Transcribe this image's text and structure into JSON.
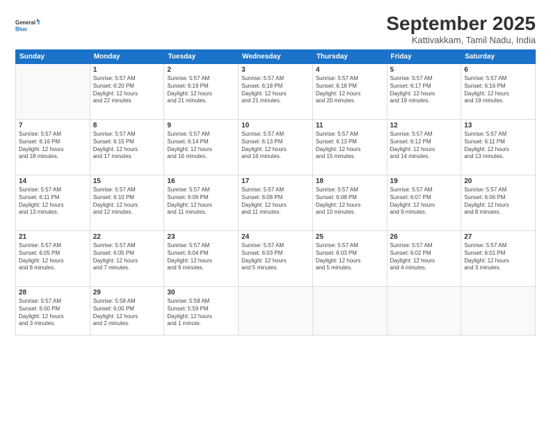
{
  "logo": {
    "line1": "General",
    "line2": "Blue"
  },
  "title": "September 2025",
  "subtitle": "Kattivakkam, Tamil Nadu, India",
  "weekdays": [
    "Sunday",
    "Monday",
    "Tuesday",
    "Wednesday",
    "Thursday",
    "Friday",
    "Saturday"
  ],
  "weeks": [
    [
      {
        "day": "",
        "info": ""
      },
      {
        "day": "1",
        "info": "Sunrise: 5:57 AM\nSunset: 6:20 PM\nDaylight: 12 hours\nand 22 minutes."
      },
      {
        "day": "2",
        "info": "Sunrise: 5:57 AM\nSunset: 6:19 PM\nDaylight: 12 hours\nand 21 minutes."
      },
      {
        "day": "3",
        "info": "Sunrise: 5:57 AM\nSunset: 6:18 PM\nDaylight: 12 hours\nand 21 minutes."
      },
      {
        "day": "4",
        "info": "Sunrise: 5:57 AM\nSunset: 6:18 PM\nDaylight: 12 hours\nand 20 minutes."
      },
      {
        "day": "5",
        "info": "Sunrise: 5:57 AM\nSunset: 6:17 PM\nDaylight: 12 hours\nand 19 minutes."
      },
      {
        "day": "6",
        "info": "Sunrise: 5:57 AM\nSunset: 6:16 PM\nDaylight: 12 hours\nand 19 minutes."
      }
    ],
    [
      {
        "day": "7",
        "info": "Sunrise: 5:57 AM\nSunset: 6:16 PM\nDaylight: 12 hours\nand 18 minutes."
      },
      {
        "day": "8",
        "info": "Sunrise: 5:57 AM\nSunset: 6:15 PM\nDaylight: 12 hours\nand 17 minutes."
      },
      {
        "day": "9",
        "info": "Sunrise: 5:57 AM\nSunset: 6:14 PM\nDaylight: 12 hours\nand 16 minutes."
      },
      {
        "day": "10",
        "info": "Sunrise: 5:57 AM\nSunset: 6:13 PM\nDaylight: 12 hours\nand 16 minutes."
      },
      {
        "day": "11",
        "info": "Sunrise: 5:57 AM\nSunset: 6:13 PM\nDaylight: 12 hours\nand 15 minutes."
      },
      {
        "day": "12",
        "info": "Sunrise: 5:57 AM\nSunset: 6:12 PM\nDaylight: 12 hours\nand 14 minutes."
      },
      {
        "day": "13",
        "info": "Sunrise: 5:57 AM\nSunset: 6:11 PM\nDaylight: 12 hours\nand 13 minutes."
      }
    ],
    [
      {
        "day": "14",
        "info": "Sunrise: 5:57 AM\nSunset: 6:11 PM\nDaylight: 12 hours\nand 13 minutes."
      },
      {
        "day": "15",
        "info": "Sunrise: 5:57 AM\nSunset: 6:10 PM\nDaylight: 12 hours\nand 12 minutes."
      },
      {
        "day": "16",
        "info": "Sunrise: 5:57 AM\nSunset: 6:09 PM\nDaylight: 12 hours\nand 11 minutes."
      },
      {
        "day": "17",
        "info": "Sunrise: 5:57 AM\nSunset: 6:08 PM\nDaylight: 12 hours\nand 11 minutes."
      },
      {
        "day": "18",
        "info": "Sunrise: 5:57 AM\nSunset: 6:08 PM\nDaylight: 12 hours\nand 10 minutes."
      },
      {
        "day": "19",
        "info": "Sunrise: 5:57 AM\nSunset: 6:07 PM\nDaylight: 12 hours\nand 9 minutes."
      },
      {
        "day": "20",
        "info": "Sunrise: 5:57 AM\nSunset: 6:06 PM\nDaylight: 12 hours\nand 8 minutes."
      }
    ],
    [
      {
        "day": "21",
        "info": "Sunrise: 5:57 AM\nSunset: 6:05 PM\nDaylight: 12 hours\nand 8 minutes."
      },
      {
        "day": "22",
        "info": "Sunrise: 5:57 AM\nSunset: 6:05 PM\nDaylight: 12 hours\nand 7 minutes."
      },
      {
        "day": "23",
        "info": "Sunrise: 5:57 AM\nSunset: 6:04 PM\nDaylight: 12 hours\nand 6 minutes."
      },
      {
        "day": "24",
        "info": "Sunrise: 5:57 AM\nSunset: 6:03 PM\nDaylight: 12 hours\nand 5 minutes."
      },
      {
        "day": "25",
        "info": "Sunrise: 5:57 AM\nSunset: 6:03 PM\nDaylight: 12 hours\nand 5 minutes."
      },
      {
        "day": "26",
        "info": "Sunrise: 5:57 AM\nSunset: 6:02 PM\nDaylight: 12 hours\nand 4 minutes."
      },
      {
        "day": "27",
        "info": "Sunrise: 5:57 AM\nSunset: 6:01 PM\nDaylight: 12 hours\nand 3 minutes."
      }
    ],
    [
      {
        "day": "28",
        "info": "Sunrise: 5:57 AM\nSunset: 6:00 PM\nDaylight: 12 hours\nand 3 minutes."
      },
      {
        "day": "29",
        "info": "Sunrise: 5:58 AM\nSunset: 6:00 PM\nDaylight: 12 hours\nand 2 minutes."
      },
      {
        "day": "30",
        "info": "Sunrise: 5:58 AM\nSunset: 5:59 PM\nDaylight: 12 hours\nand 1 minute."
      },
      {
        "day": "",
        "info": ""
      },
      {
        "day": "",
        "info": ""
      },
      {
        "day": "",
        "info": ""
      },
      {
        "day": "",
        "info": ""
      }
    ]
  ]
}
